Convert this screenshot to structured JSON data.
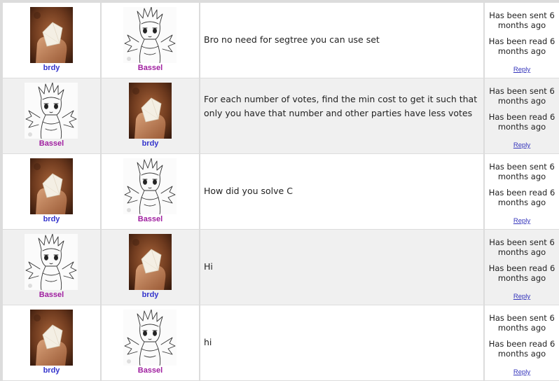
{
  "users": {
    "brdy": "brdy",
    "bassel": "Bassel"
  },
  "colors": {
    "brdy_handle": "#3333cc",
    "bassel_handle": "#a020a0",
    "link": "#3333bb"
  },
  "messages": [
    {
      "from": "brdy",
      "to": "Bassel",
      "text": "Bro no need for segtree you can use set",
      "sent": "Has been sent 6 months ago",
      "read": "Has been read 6 months ago",
      "reply": "Reply"
    },
    {
      "from": "Bassel",
      "to": "brdy",
      "text": "For each number of votes, find the min cost to get it such that only you have that number and other parties have less votes",
      "sent": "Has been sent 6 months ago",
      "read": "Has been read 6 months ago",
      "reply": "Reply"
    },
    {
      "from": "brdy",
      "to": "Bassel",
      "text": "How did you solve C",
      "sent": "Has been sent 6 months ago",
      "read": "Has been read 6 months ago",
      "reply": "Reply"
    },
    {
      "from": "Bassel",
      "to": "brdy",
      "text": "Hi",
      "sent": "Has been sent 6 months ago",
      "read": "Has been read 6 months ago",
      "reply": "Reply"
    },
    {
      "from": "brdy",
      "to": "Bassel",
      "text": "hi",
      "sent": "Has been sent 6 months ago",
      "read": "Has been read 6 months ago",
      "reply": "Reply"
    }
  ]
}
